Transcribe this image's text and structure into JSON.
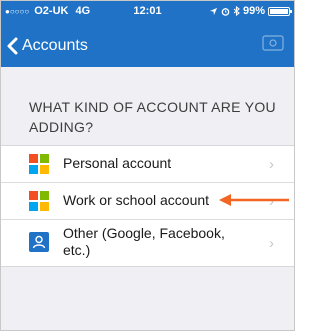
{
  "status_bar": {
    "signal_dots": "●○○○○",
    "carrier": "O2-UK",
    "network": "4G",
    "time": "12:01",
    "icons": [
      "location-arrow-icon",
      "alarm-icon",
      "bluetooth-icon"
    ],
    "battery_percent": "99%",
    "battery_level": 0.99
  },
  "nav": {
    "back_label": "Accounts",
    "settings_icon": "settings-icon"
  },
  "section": {
    "title": "WHAT KIND OF ACCOUNT ARE YOU ADDING?"
  },
  "accounts": [
    {
      "label": "Personal account",
      "icon": "microsoft-logo-icon"
    },
    {
      "label": "Work or school account",
      "icon": "microsoft-logo-icon"
    },
    {
      "label": "Other (Google, Facebook, etc.)",
      "icon": "person-icon"
    }
  ],
  "colors": {
    "header": "#1f72c5",
    "background": "#efeff4",
    "arrow": "#f26522",
    "ms_red": "#f25022",
    "ms_green": "#7fba00",
    "ms_blue": "#00a4ef",
    "ms_yellow": "#ffb900"
  }
}
